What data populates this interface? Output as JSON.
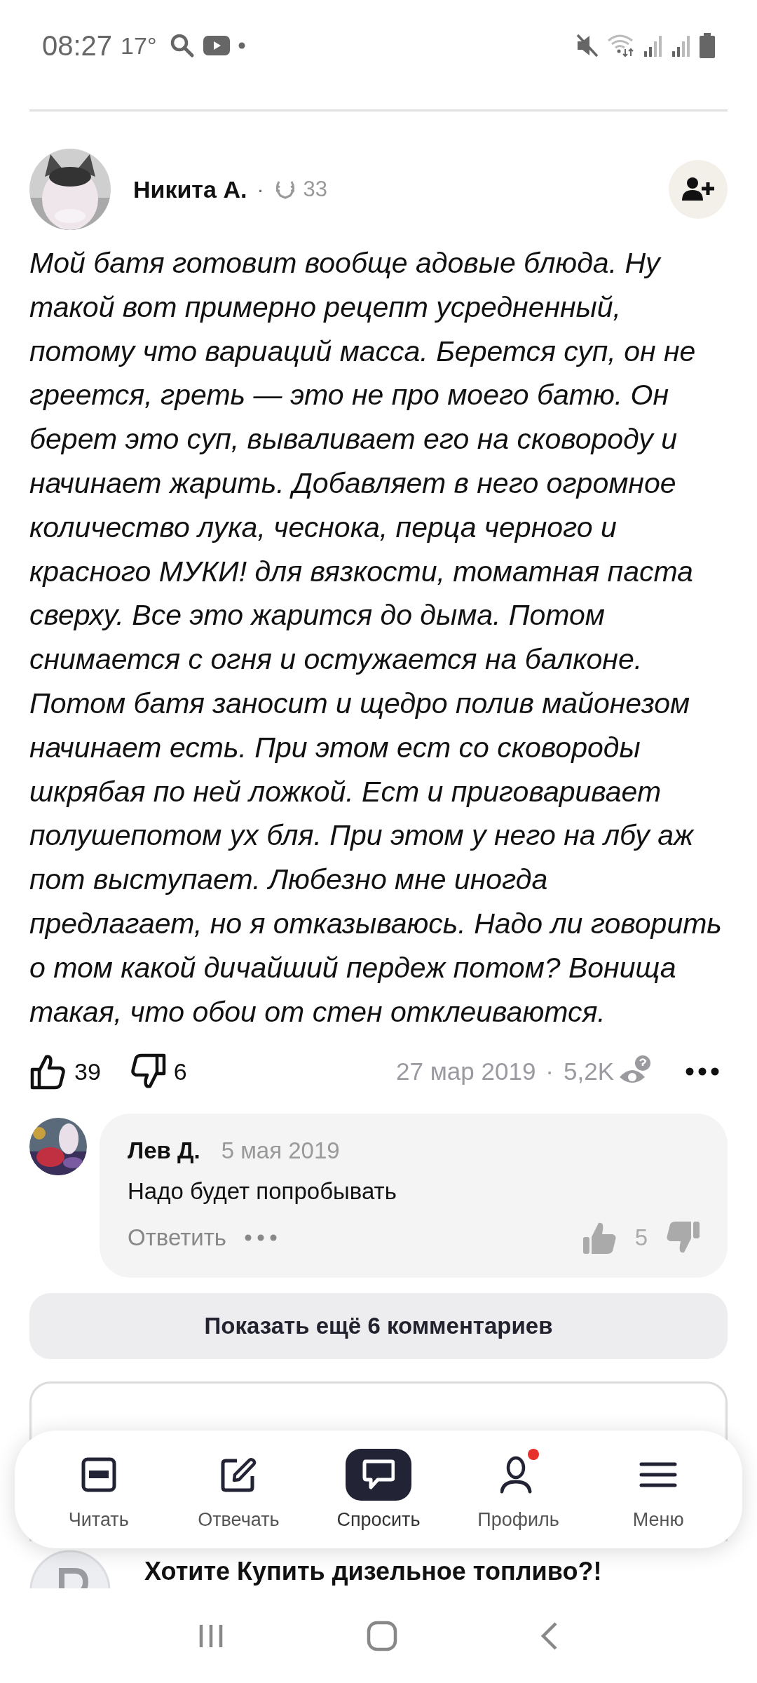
{
  "status_bar": {
    "time": "08:27",
    "temperature": "17°"
  },
  "post": {
    "author": "Никита А.",
    "author_separator": "·",
    "rating": "33",
    "body": "Мой батя готовит вообще адовые блюда. Ну такой вот примерно рецепт усредненный, потому что вариаций масса. Берется суп, он не греется, греть — это не про моего батю. Он берет это суп, вываливает его на сковороду и начинает жарить. Добавляет в него огромное количество лука, чеснока, перца черного и красного МУКИ! для вязкости, томатная паста сверху. Все это жарится до дыма. Потом снимается с огня и остужается на балконе. Потом батя заносит и щедро полив майонезом начинает есть. При этом ест со сковороды шкрябая по ней ложкой. Ест и приговаривает полушепотом ух бля. При этом у него на лбу аж пот выступает. Любезно мне иногда предлагает, но я отказываюсь. Надо ли говорить о том какой дичайший пердеж потом? Вонища такая, что обои от стен отклеиваются.",
    "likes": "39",
    "dislikes": "6",
    "date": "27 мар 2019",
    "meta_separator": "·",
    "views": "5,2K"
  },
  "reply": {
    "author": "Лев Д.",
    "date": "5 мая 2019",
    "text": "Надо будет попробывать",
    "reply_label": "Ответить",
    "likes": "5"
  },
  "show_more": "Показать ещё 6 комментариев",
  "bottom_nav": [
    {
      "kind": "read",
      "label": "Читать",
      "selected": false,
      "badge": false
    },
    {
      "kind": "answer",
      "label": "Отвечать",
      "selected": false,
      "badge": false
    },
    {
      "kind": "ask",
      "label": "Спросить",
      "selected": true,
      "badge": false
    },
    {
      "kind": "profile",
      "label": "Профиль",
      "selected": false,
      "badge": true
    },
    {
      "kind": "menu",
      "label": "Меню",
      "selected": false,
      "badge": false
    }
  ],
  "next_item": {
    "title": "Хотите Купить дизельное топливо?!"
  }
}
